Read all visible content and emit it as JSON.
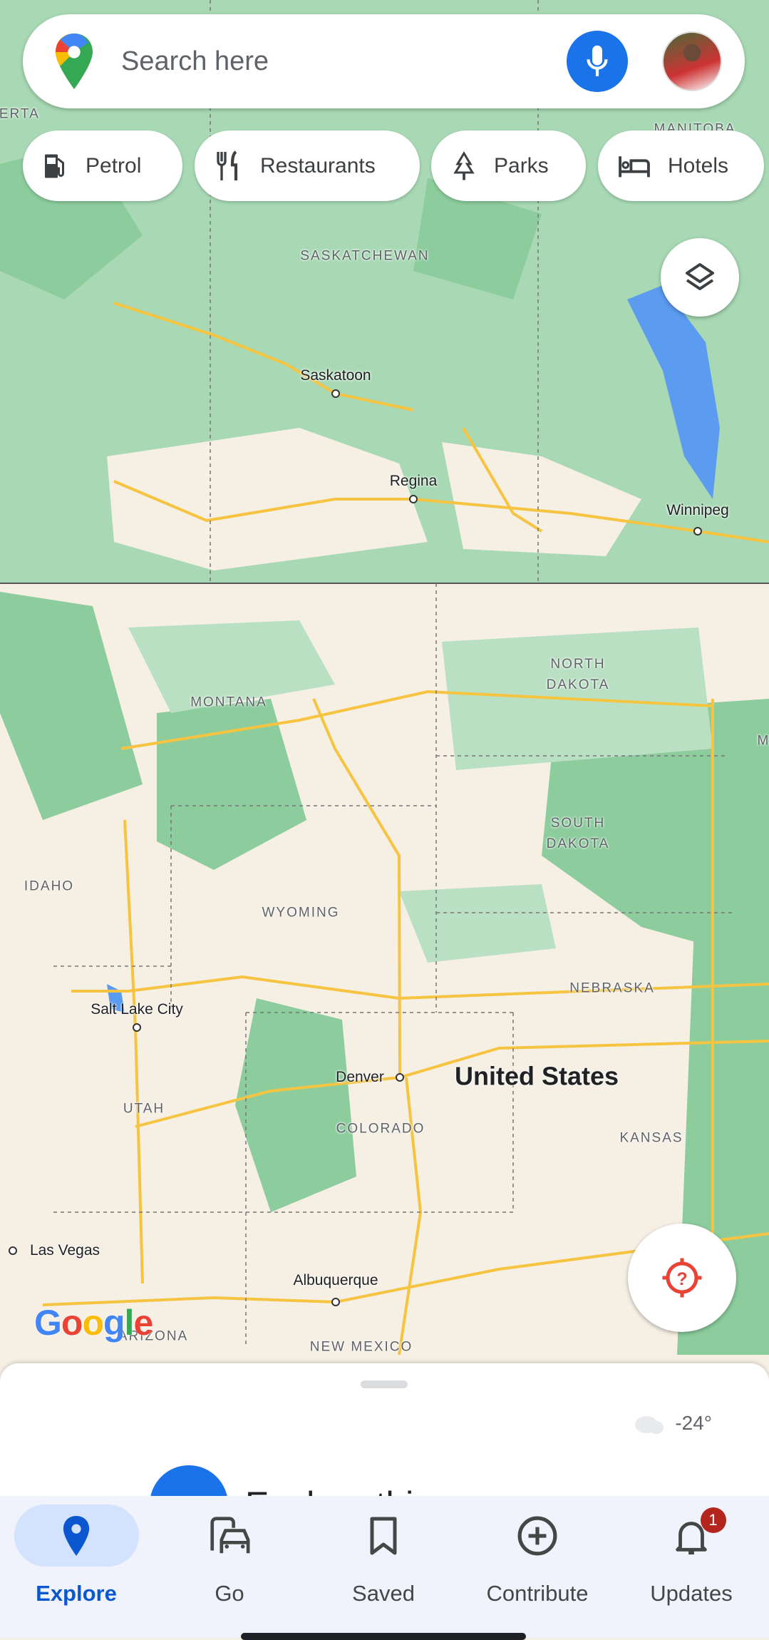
{
  "search": {
    "placeholder": "Search here"
  },
  "chips": [
    {
      "label": "Petrol",
      "icon": "fuel-icon"
    },
    {
      "label": "Restaurants",
      "icon": "fork-knife-icon"
    },
    {
      "label": "Parks",
      "icon": "tree-icon"
    },
    {
      "label": "Hotels",
      "icon": "bed-icon"
    }
  ],
  "map": {
    "regions": [
      "BERTA",
      "MANITOBA",
      "SASKATCHEWAN",
      "NORTH\nDAKOTA",
      "MONTANA",
      "MI",
      "SOUTH\nDAKOTA",
      "IDAHO",
      "WYOMING",
      "NEBRASKA",
      "UTAH",
      "COLORADO",
      "KANSAS",
      "ARIZONA",
      "NEW MEXICO"
    ],
    "cities": [
      "Saskatoon",
      "Regina",
      "Winnipeg",
      "Salt Lake City",
      "Denver",
      "Las Vegas",
      "Albuquerque"
    ],
    "country": "United States",
    "logo": "Google"
  },
  "sheet": {
    "temperature": "-24°",
    "explore_title": "Explore this area"
  },
  "nav": [
    {
      "label": "Explore",
      "active": true
    },
    {
      "label": "Go"
    },
    {
      "label": "Saved"
    },
    {
      "label": "Contribute"
    },
    {
      "label": "Updates",
      "badge": "1"
    }
  ],
  "colors": {
    "accent": "#1a73e8",
    "badge": "#b3261e",
    "road": "#f6c440",
    "land": "#f5efe4",
    "forest": "#b9e0c2",
    "water": "#5b9bf0"
  }
}
